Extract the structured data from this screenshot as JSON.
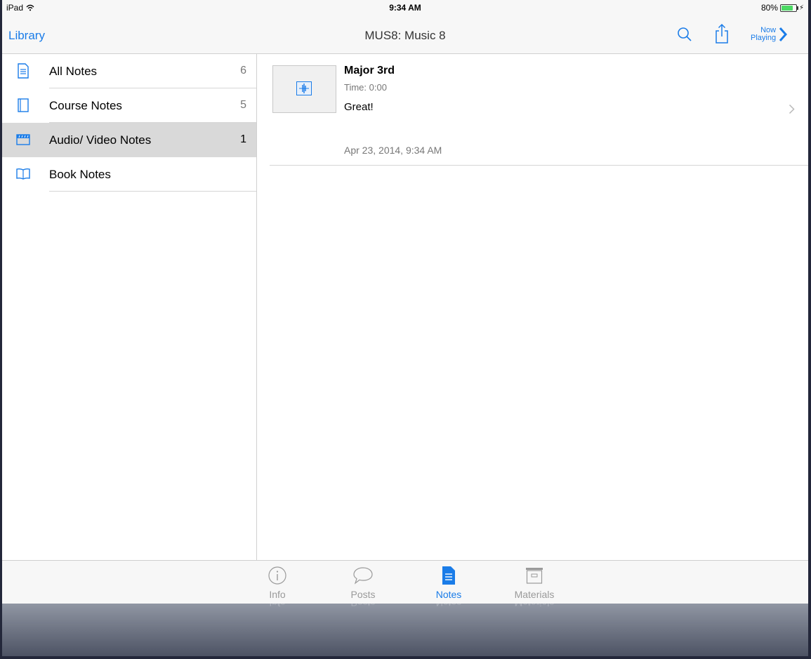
{
  "status": {
    "device": "iPad",
    "time": "9:34 AM",
    "battery": "80%"
  },
  "nav": {
    "back_label": "Library",
    "title": "MUS8: Music 8",
    "now_playing_line1": "Now",
    "now_playing_line2": "Playing"
  },
  "sidebar": {
    "items": [
      {
        "label": "All Notes",
        "count": "6",
        "icon": "document-icon"
      },
      {
        "label": "Course Notes",
        "count": "5",
        "icon": "notebook-icon"
      },
      {
        "label": "Audio/ Video Notes",
        "count": "1",
        "icon": "clapperboard-icon",
        "selected": true
      },
      {
        "label": "Book Notes",
        "count": "",
        "icon": "open-book-icon"
      }
    ]
  },
  "note": {
    "title": "Major 3rd",
    "time": "Time: 0:00",
    "text": "Great!",
    "date": "Apr 23, 2014, 9:34 AM"
  },
  "tabs": [
    {
      "label": "Info",
      "icon": "info-icon"
    },
    {
      "label": "Posts",
      "icon": "speech-bubble-icon"
    },
    {
      "label": "Notes",
      "icon": "notes-icon",
      "active": true
    },
    {
      "label": "Materials",
      "icon": "archive-box-icon"
    }
  ],
  "colors": {
    "accent": "#1a7ce8",
    "selected_row": "#d9d9d9",
    "battery": "#4cd964"
  }
}
